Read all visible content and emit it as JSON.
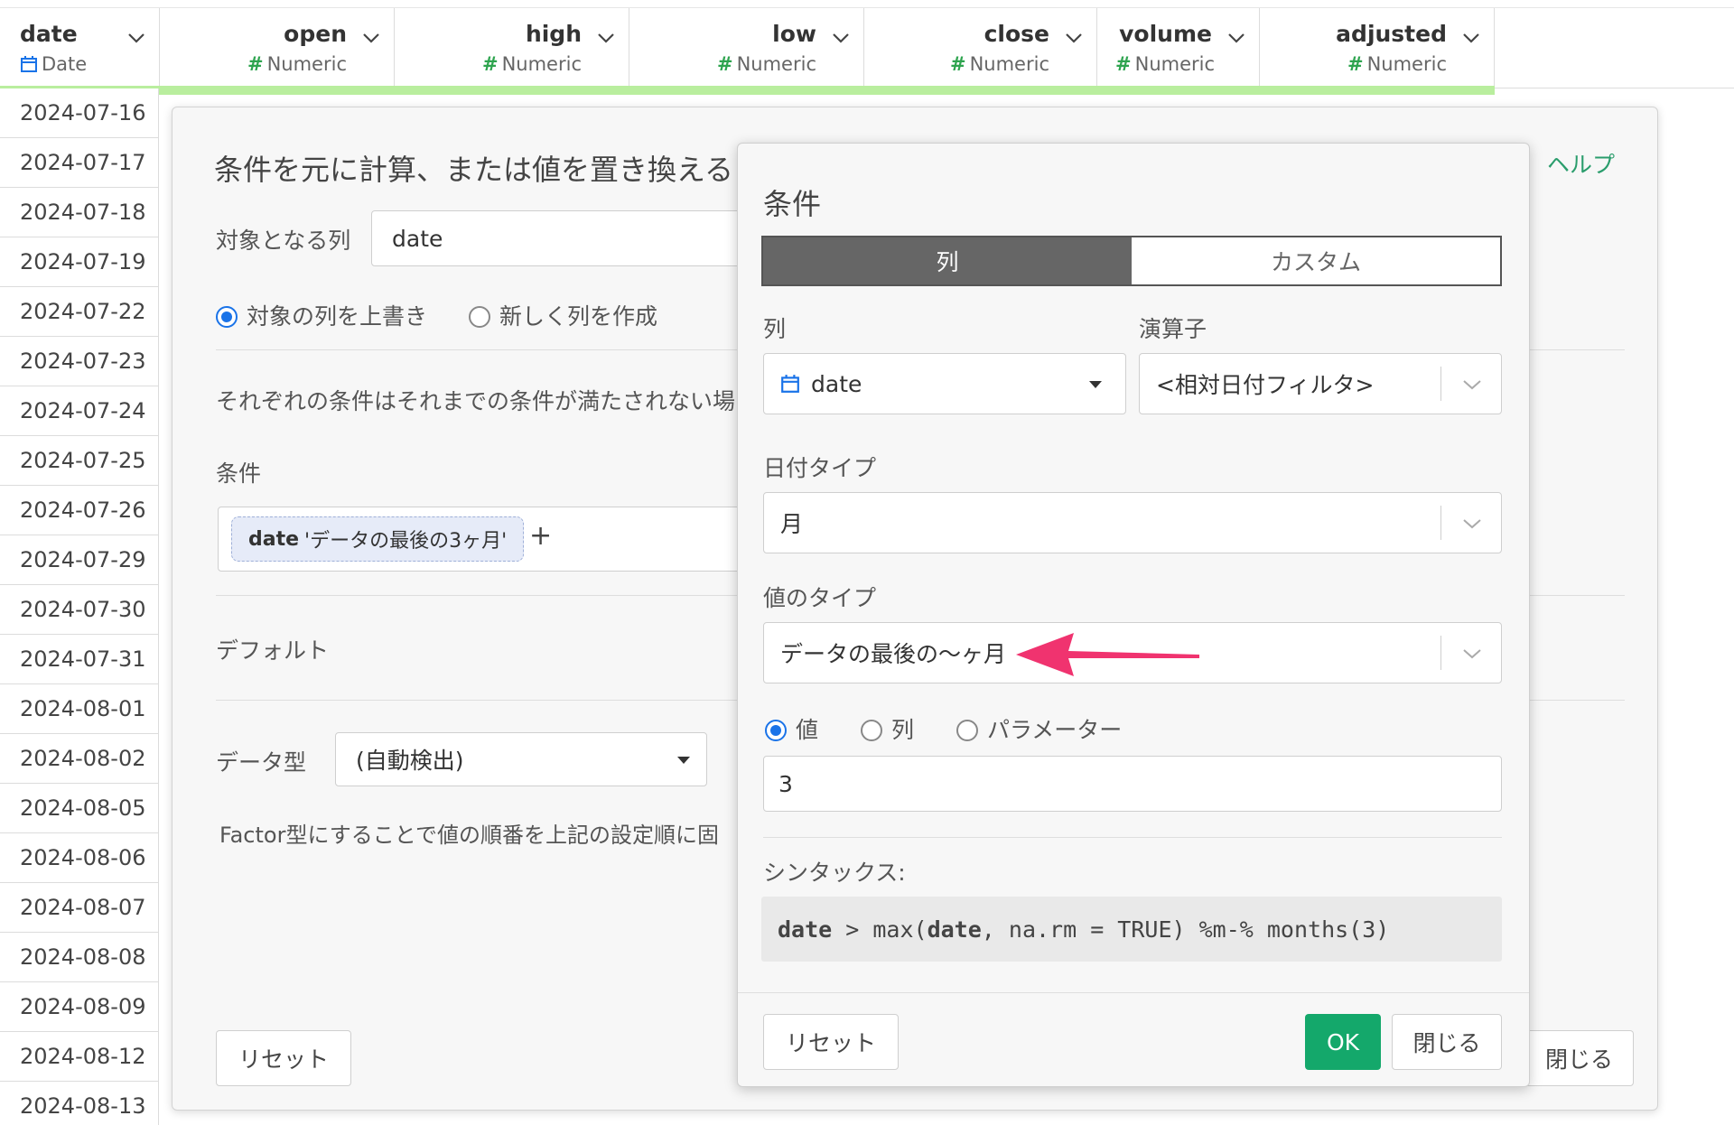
{
  "grid": {
    "columns": [
      {
        "name": "date",
        "type": "Date"
      },
      {
        "name": "open",
        "type": "Numeric"
      },
      {
        "name": "high",
        "type": "Numeric"
      },
      {
        "name": "low",
        "type": "Numeric"
      },
      {
        "name": "close",
        "type": "Numeric"
      },
      {
        "name": "volume",
        "type": "Numeric"
      },
      {
        "name": "adjusted",
        "type": "Numeric"
      }
    ],
    "type_hash": "#",
    "dates": [
      "2024-07-16",
      "2024-07-17",
      "2024-07-18",
      "2024-07-19",
      "2024-07-22",
      "2024-07-23",
      "2024-07-24",
      "2024-07-25",
      "2024-07-26",
      "2024-07-29",
      "2024-07-30",
      "2024-07-31",
      "2024-08-01",
      "2024-08-02",
      "2024-08-05",
      "2024-08-06",
      "2024-08-07",
      "2024-08-08",
      "2024-08-09",
      "2024-08-12",
      "2024-08-13"
    ],
    "header_accent": "#b9ee9e"
  },
  "outer_dialog": {
    "title": "条件を元に計算、または値を置き換える",
    "help": "ヘルプ",
    "target_label": "対象となる列",
    "target_value": "date",
    "radio_overwrite": "対象の列を上書き",
    "radio_new": "新しく列を作成",
    "description": "それぞれの条件はそれまでの条件が満たされない場",
    "conditions_label": "条件",
    "condition_chip_col": "date",
    "condition_chip_text": "'データの最後の3ヶ月'",
    "add_symbol": "+",
    "default_label": "デフォルト",
    "datatype_label": "データ型",
    "datatype_value": "(自動検出)",
    "factor_note": "Factor型にすることで値の順番を上記の設定順に固",
    "reset": "リセット",
    "close": "閉じる"
  },
  "inner_dialog": {
    "title": "条件",
    "tab_column": "列",
    "tab_custom": "カスタム",
    "column_label": "列",
    "column_value": "date",
    "operator_label": "演算子",
    "operator_value": "<相対日付フィルタ>",
    "date_type_label": "日付タイプ",
    "date_type_value": "月",
    "value_type_label": "値のタイプ",
    "value_type_value": "データの最後の〜ヶ月",
    "radio_value": "値",
    "radio_column": "列",
    "radio_parameter": "パラメーター",
    "value_input": "3",
    "syntax_label": "シンタックス:",
    "syntax_kw1": "date",
    "syntax_mid": " > max(",
    "syntax_kw2": "date",
    "syntax_tail": ", na.rm = TRUE) %m-% months(3)",
    "reset": "リセット",
    "ok": "OK",
    "close": "閉じる"
  },
  "colors": {
    "accent_green": "#14a86b",
    "annotation_arrow": "#f0336f",
    "radio_blue": "#1a73e8"
  }
}
